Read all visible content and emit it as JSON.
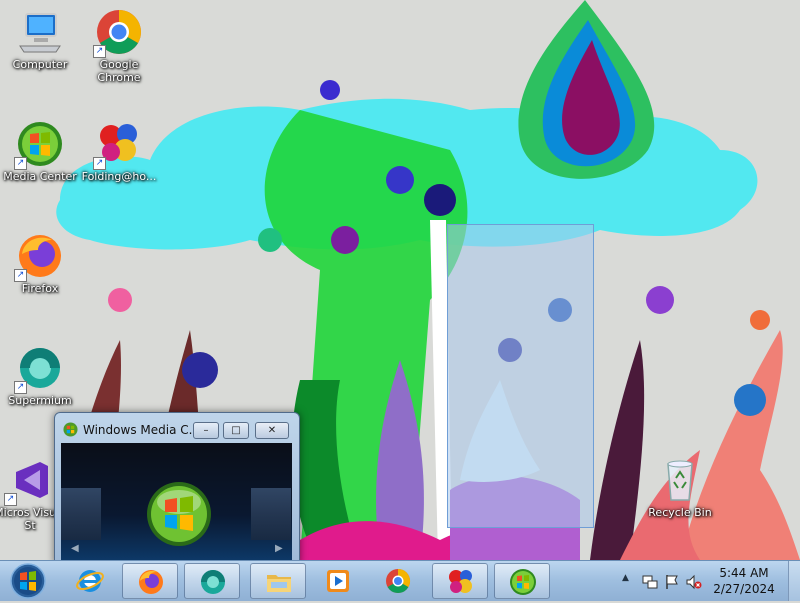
{
  "desktop": {
    "icons": [
      {
        "label": "Computer",
        "icon": "computer-icon"
      },
      {
        "label": "Google Chrome",
        "icon": "chrome-icon"
      },
      {
        "label": "Media Center",
        "icon": "windows-media-center-icon"
      },
      {
        "label": "Folding@ho...",
        "icon": "folding-at-home-icon"
      },
      {
        "label": "Firefox",
        "icon": "firefox-icon"
      },
      {
        "label": "Supermium",
        "icon": "supermium-icon"
      },
      {
        "label": "Micros Visual St",
        "icon": "visual-studio-icon"
      },
      {
        "label": "Recycle Bin",
        "icon": "recycle-bin-icon"
      }
    ]
  },
  "wmc_window": {
    "title": "Windows Media C...",
    "minimize": "–",
    "maximize": "□",
    "close": "✕"
  },
  "taskbar": {
    "items": [
      {
        "name": "internet-explorer",
        "icon": "internet-explorer-icon"
      },
      {
        "name": "firefox",
        "icon": "firefox-icon"
      },
      {
        "name": "supermium",
        "icon": "supermium-icon"
      },
      {
        "name": "windows-explorer",
        "icon": "folder-icon"
      },
      {
        "name": "windows-media-player",
        "icon": "media-player-icon"
      },
      {
        "name": "google-chrome",
        "icon": "chrome-icon"
      },
      {
        "name": "folding-at-home",
        "icon": "folding-at-home-icon"
      },
      {
        "name": "windows-media-center",
        "icon": "windows-media-center-icon"
      }
    ]
  },
  "tray": {
    "show_hidden": "▲",
    "time": "5:44 AM",
    "date": "2/27/2024"
  },
  "colors": {
    "taskbar": "#9ebedf",
    "selection": "#aac8eb",
    "chrome_red": "#db4437",
    "chrome_green": "#0f9d58",
    "chrome_yellow": "#f4b400",
    "chrome_blue": "#4285f4"
  }
}
